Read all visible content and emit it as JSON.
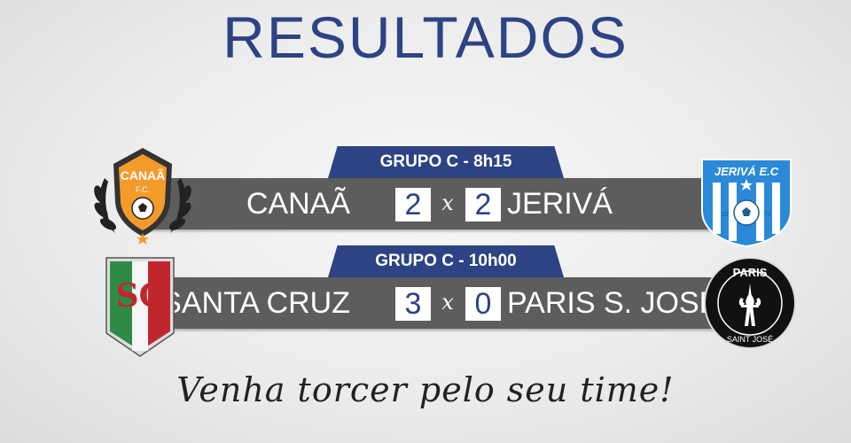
{
  "title": "RESULTADOS",
  "matches": [
    {
      "group": "GRUPO C - 8h15",
      "home": {
        "name": "CANAÃ",
        "score": "2",
        "logo_text": "CANAÃ",
        "logo_sub": "F.C."
      },
      "separator": "x",
      "away": {
        "name": "JERIVÁ",
        "score": "2",
        "logo_text": "JERIVÁ E.C",
        "logo_year_left": "19",
        "logo_year_right": "72"
      }
    },
    {
      "group": "GRUPO C - 10h00",
      "home": {
        "name": "SANTA CRUZ",
        "score": "3",
        "logo_text": "SC"
      },
      "separator": "x",
      "away": {
        "name": "PARIS S. JOSÉ",
        "score": "0",
        "logo_text": "PARIS",
        "logo_sub": "SAINT JOSÉ"
      }
    }
  ],
  "slogan": "Venha torcer pelo seu time!",
  "colors": {
    "accent": "#2d4383",
    "bar": "#5d5d5d",
    "canaa_orange": "#f39a2a",
    "jeriva_blue": "#2a8ad8",
    "santacruz_green": "#2e8b45",
    "santacruz_red": "#c0272d"
  }
}
